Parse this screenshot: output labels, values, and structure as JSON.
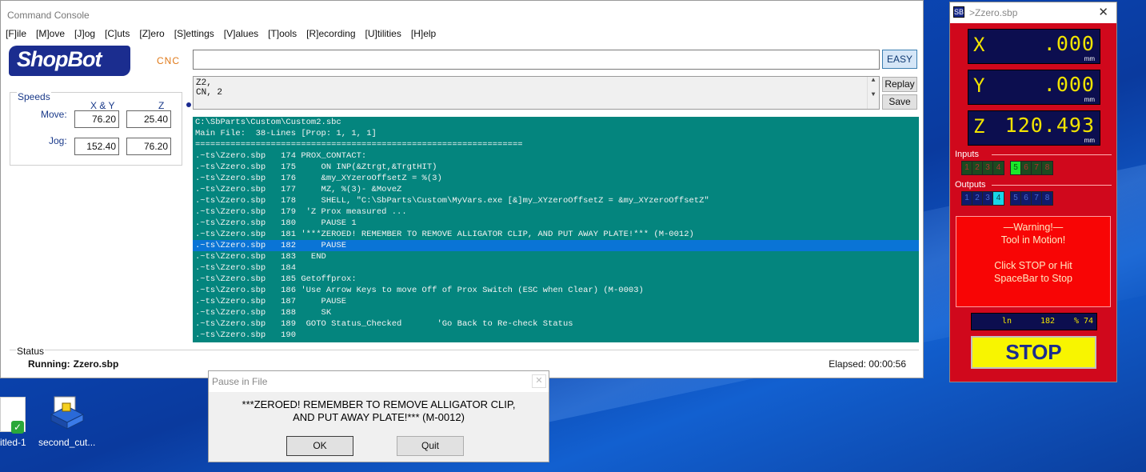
{
  "console": {
    "title": "Command Console",
    "menu": [
      "[F]ile",
      "[M]ove",
      "[J]og",
      "[C]uts",
      "[Z]ero",
      "[S]ettings",
      "[V]alues",
      "[T]ools",
      "[R]ecording",
      "[U]tilities",
      "[H]elp"
    ],
    "logo_text": "ShopBot",
    "logo_suffix": "CNC",
    "command_value": "",
    "easy_label": "EASY",
    "replay_label": "Replay",
    "save_label": "Save",
    "history": [
      "Z2,",
      "CN, 2"
    ],
    "speeds": {
      "legend": "Speeds",
      "col_xy": "X & Y",
      "col_z": "Z",
      "move_label": "Move:",
      "jog_label": "Jog:",
      "move_xy": "76.20",
      "move_z": "25.40",
      "jog_xy": "152.40",
      "jog_z": "76.20"
    },
    "file_lines": [
      {
        "text": "C:\\SbParts\\Custom\\Custom2.sbc",
        "selected": false
      },
      {
        "text": "Main File:  38-Lines [Prop: 1, 1, 1]",
        "selected": false
      },
      {
        "text": "=================================================================",
        "selected": false
      },
      {
        "text": ".~ts\\Zzero.sbp   174 PROX_CONTACT:",
        "selected": false
      },
      {
        "text": ".~ts\\Zzero.sbp   175     ON INP(&Ztrgt,&TrgtHIT)",
        "selected": false
      },
      {
        "text": ".~ts\\Zzero.sbp   176     &my_XYzeroOffsetZ = %(3)",
        "selected": false
      },
      {
        "text": ".~ts\\Zzero.sbp   177     MZ, %(3)- &MoveZ",
        "selected": false
      },
      {
        "text": ".~ts\\Zzero.sbp   178     SHELL, \"C:\\SbParts\\Custom\\MyVars.exe [&]my_XYzeroOffsetZ = &my_XYzeroOffsetZ\"",
        "selected": false
      },
      {
        "text": ".~ts\\Zzero.sbp   179  'Z Prox measured ...",
        "selected": false
      },
      {
        "text": ".~ts\\Zzero.sbp   180     PAUSE 1",
        "selected": false
      },
      {
        "text": ".~ts\\Zzero.sbp   181 '***ZEROED! REMEMBER TO REMOVE ALLIGATOR CLIP, AND PUT AWAY PLATE!*** (M-0012)",
        "selected": false
      },
      {
        "text": ".~ts\\Zzero.sbp   182     PAUSE",
        "selected": true
      },
      {
        "text": ".~ts\\Zzero.sbp   183   END",
        "selected": false
      },
      {
        "text": ".~ts\\Zzero.sbp   184",
        "selected": false
      },
      {
        "text": ".~ts\\Zzero.sbp   185 Getoffprox:",
        "selected": false
      },
      {
        "text": ".~ts\\Zzero.sbp   186 'Use Arrow Keys to move Off of Prox Switch (ESC when Clear) (M-0003)",
        "selected": false
      },
      {
        "text": ".~ts\\Zzero.sbp   187     PAUSE",
        "selected": false
      },
      {
        "text": ".~ts\\Zzero.sbp   188     SK",
        "selected": false
      },
      {
        "text": ".~ts\\Zzero.sbp   189  GOTO Status_Checked       'Go Back to Re-check Status",
        "selected": false
      },
      {
        "text": ".~ts\\Zzero.sbp   190",
        "selected": false
      }
    ],
    "status": {
      "legend": "Status",
      "running_label": "Running:",
      "running_file": "Zzero.sbp",
      "elapsed": "Elapsed: 00:00:56"
    }
  },
  "dro": {
    "title": ">Zzero.sbp",
    "app_icon": "SB",
    "close_glyph": "✕",
    "x_label": "X",
    "x_value": ".000",
    "y_label": "Y",
    "y_value": ".000",
    "z_label": "Z",
    "z_value": "120.493",
    "unit": "mm",
    "inputs_label": "Inputs",
    "outputs_label": "Outputs",
    "inputs": [
      {
        "n": "1",
        "on": false
      },
      {
        "n": "2",
        "on": false
      },
      {
        "n": "3",
        "on": false
      },
      {
        "n": "4",
        "on": false
      },
      {
        "n": "5",
        "on": true
      },
      {
        "n": "6",
        "on": false
      },
      {
        "n": "7",
        "on": false
      },
      {
        "n": "8",
        "on": false
      }
    ],
    "outputs": [
      {
        "n": "1",
        "on": false
      },
      {
        "n": "2",
        "on": false
      },
      {
        "n": "3",
        "on": false
      },
      {
        "n": "4",
        "on": true
      },
      {
        "n": "5",
        "on": false
      },
      {
        "n": "6",
        "on": false
      },
      {
        "n": "7",
        "on": false
      },
      {
        "n": "8",
        "on": false
      }
    ],
    "warning_title": "—Warning!—",
    "warning_line2": "Tool in Motion!",
    "warning_line3": "Click STOP or Hit",
    "warning_line4": "SpaceBar to Stop",
    "ln_label": "ln",
    "ln_value": "182",
    "pct_label": "% 74",
    "stop_label": "STOP"
  },
  "desktop": {
    "icon1_label": "itled-1",
    "icon2_label": "second_cut..."
  },
  "pause_dialog": {
    "title": "Pause in File",
    "close_glyph": "✕",
    "message_line1": "***ZEROED! REMEMBER TO REMOVE ALLIGATOR CLIP,",
    "message_line2": "AND PUT AWAY PLATE!*** (M-0012)",
    "ok_label": "OK",
    "quit_label": "Quit"
  },
  "colors": {
    "file_panel_bg": "#04857e",
    "selected_line": "#0a74d6",
    "dro_bg": "#d0081c",
    "dro_digits": "#f2e400",
    "stop_yellow": "#f8f500",
    "brand_blue": "#1b2d8f"
  }
}
